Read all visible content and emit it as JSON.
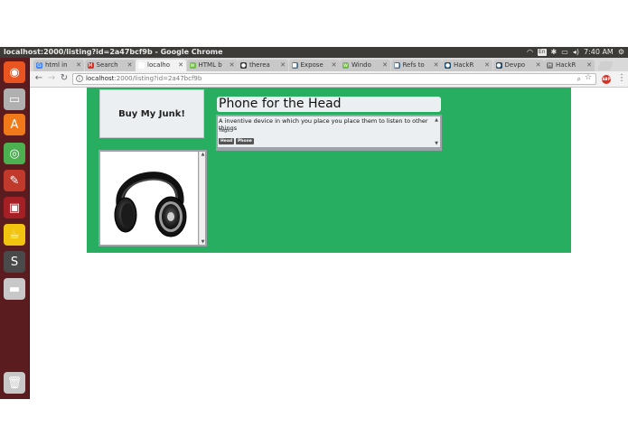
{
  "os": {
    "window_title": "localhost:2000/listing?id=2a47bcf9b - Google Chrome",
    "tray": {
      "keyboard": "En",
      "clock": "7:40 AM"
    }
  },
  "launcher": {
    "items": [
      {
        "name": "ubuntu-dash-icon",
        "color": "#e95420",
        "glyph": "◉"
      },
      {
        "name": "files-drawer-icon",
        "color": "#b0b0b0",
        "glyph": "▭"
      },
      {
        "name": "software-center-icon",
        "color": "#f07a1a",
        "glyph": "A"
      },
      {
        "name": "chrome-icon",
        "color": "#4caf50",
        "glyph": "◎"
      },
      {
        "name": "system-settings-icon",
        "color": "#c0392b",
        "glyph": "✎"
      },
      {
        "name": "terminal-window-icon",
        "color": "#a42024",
        "glyph": "▣"
      },
      {
        "name": "gnome-mascot-icon",
        "color": "#f1c40f",
        "glyph": "☕"
      },
      {
        "name": "sublime-text-icon",
        "color": "#4a4a4a",
        "glyph": "S"
      },
      {
        "name": "drive-icon",
        "color": "#c8c8c8",
        "glyph": "▬"
      },
      {
        "name": "trash-icon",
        "color": "#c8c8c8",
        "glyph": "🗑"
      }
    ]
  },
  "browser": {
    "tabs": [
      {
        "label": "html in",
        "favicon": "G",
        "favicon_color": "#4285f4",
        "active": false
      },
      {
        "label": "Search",
        "favicon": "M",
        "favicon_color": "#d93025",
        "active": false
      },
      {
        "label": "localho",
        "favicon": "",
        "favicon_color": "#ffffff",
        "active": true
      },
      {
        "label": "HTML b",
        "favicon": "w",
        "favicon_color": "#6fbd44",
        "active": false
      },
      {
        "label": "therea",
        "favicon": "●",
        "favicon_color": "#333333",
        "active": false
      },
      {
        "label": "Expose",
        "favicon": "■",
        "favicon_color": "#3d6b8c",
        "active": false
      },
      {
        "label": "Windo",
        "favicon": "w",
        "favicon_color": "#6fbd44",
        "active": false
      },
      {
        "label": "Refs to",
        "favicon": "■",
        "favicon_color": "#3d6b8c",
        "active": false
      },
      {
        "label": "HackR",
        "favicon": "●",
        "favicon_color": "#1c4a6e",
        "active": false
      },
      {
        "label": "Devpo",
        "favicon": "●",
        "favicon_color": "#1c4a6e",
        "active": false
      },
      {
        "label": "HackR",
        "favicon": "H",
        "favicon_color": "#777777",
        "active": false
      }
    ],
    "url": {
      "host": "localhost",
      "rest": ":2000/listing?id=2a47bcf9b"
    },
    "extension_badge": "ABP"
  },
  "page": {
    "brand": "Buy My Junk!",
    "listing": {
      "title": "Phone for the Head",
      "description": "A inventive device in which you place you place them to listen to other things",
      "tags_label": "Tags:",
      "tags": [
        "Head",
        "Phone"
      ]
    },
    "colors": {
      "accent": "#27ae60",
      "panel": "#eceff1"
    }
  }
}
